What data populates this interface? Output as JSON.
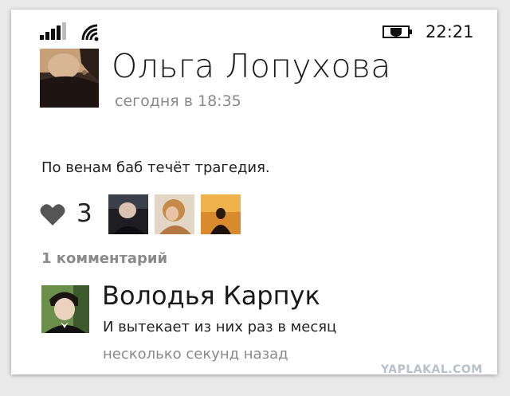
{
  "status_bar": {
    "time": "22:21",
    "signal_icon": "cellular-signal-icon",
    "wifi_icon": "wifi-icon",
    "battery_icon": "battery-saver-icon"
  },
  "post": {
    "author_name": "Ольга Лопухова",
    "timestamp": "сегодня в 18:35",
    "text": "По венам баб течёт трагедия.",
    "like_icon": "heart-icon",
    "like_count": "3",
    "comments_label": "1 комментарий"
  },
  "comment": {
    "author_name": "Володья Карпук",
    "text": "И вытекает из них раз в месяц",
    "timestamp": "несколько секунд назад"
  },
  "watermark": "YAPLAKAL.COM",
  "colors": {
    "background": "#ffffff",
    "secondary_text": "#8a8a8a",
    "primary_text": "#222222",
    "heart": "#555555"
  }
}
